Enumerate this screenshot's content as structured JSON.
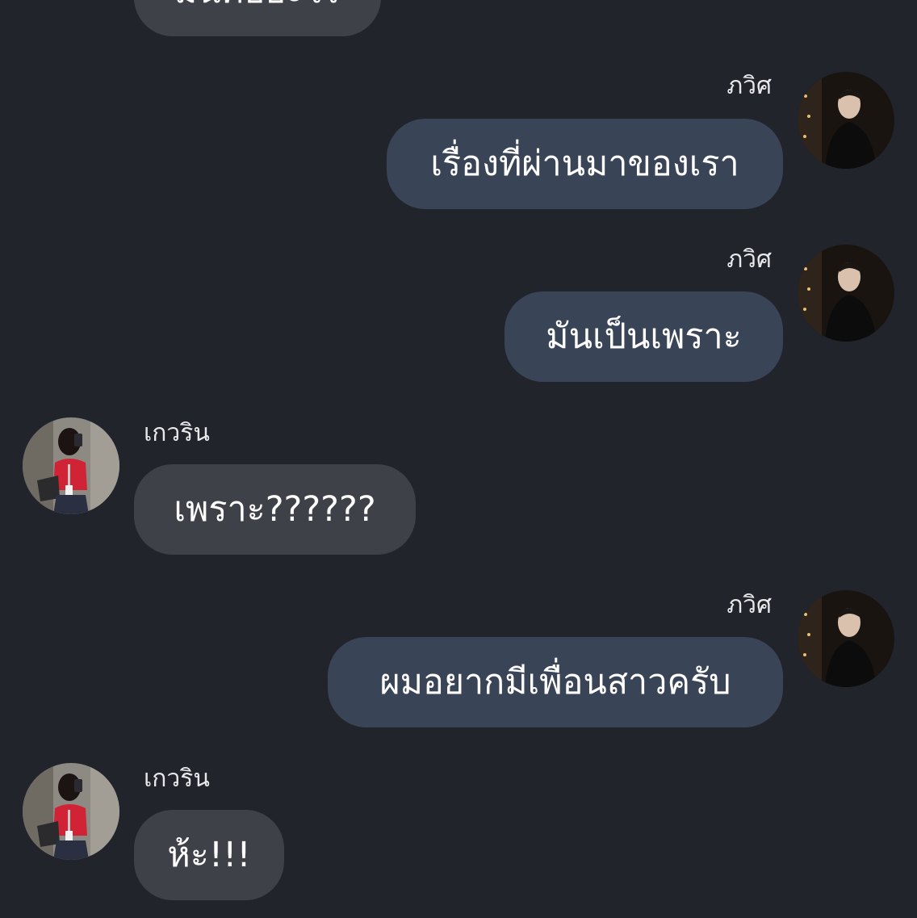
{
  "conversation": {
    "messages": [
      {
        "sender": "",
        "side": "left",
        "text": "มันคืออะไร"
      },
      {
        "sender": "ภวิศ",
        "side": "right",
        "text": "เรื่องที่ผ่านมาของเรา"
      },
      {
        "sender": "ภวิศ",
        "side": "right",
        "text": "มันเป็นเพราะ"
      },
      {
        "sender": "เกวริน",
        "side": "left",
        "text": "เพราะ??????"
      },
      {
        "sender": "ภวิศ",
        "side": "right",
        "text": "ผมอยากมีเพื่อนสาวครับ"
      },
      {
        "sender": "เกวริน",
        "side": "left",
        "text": "ห้ะ!!!"
      }
    ]
  },
  "colors": {
    "background": "#22242b",
    "incoming_bubble": "#3f4148",
    "outgoing_bubble": "#3a4457",
    "text": "#ffffff"
  },
  "icons": {
    "outgoing_avatar": "avatar-man-dark-jacket",
    "incoming_avatar": "avatar-woman-red-top"
  }
}
